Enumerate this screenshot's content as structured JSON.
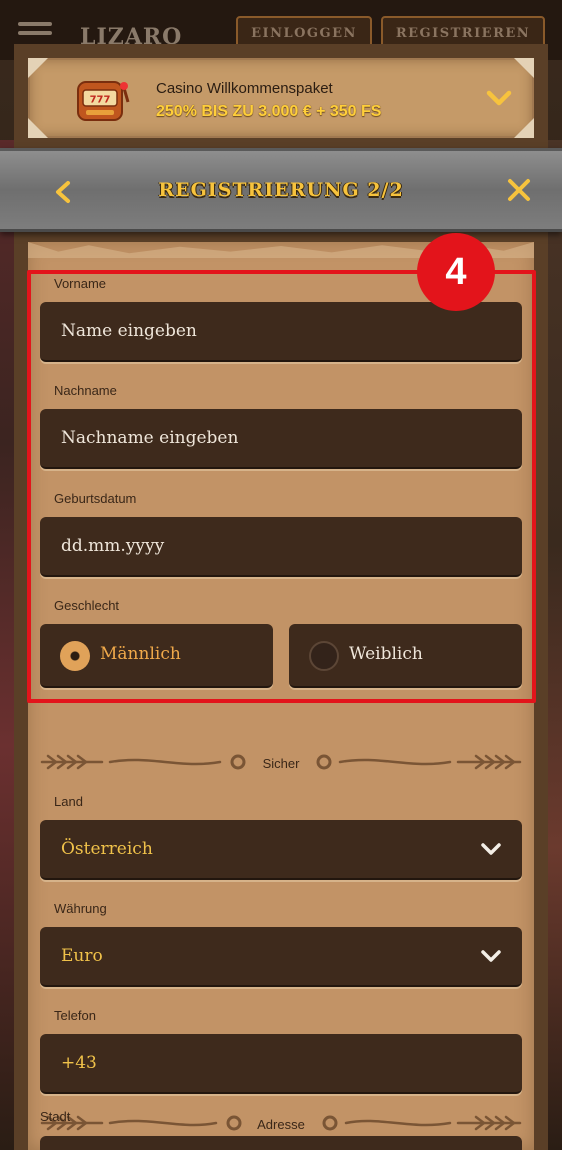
{
  "topbar": {
    "logo_text": "LIZARO",
    "login_label": "EINLOGGEN",
    "register_label": "REGISTRIEREN"
  },
  "promo": {
    "title": "Casino Willkommenspaket",
    "offer": "250% BIS ZU 3.000 € + 350 FS",
    "icon": "slot-machine-icon"
  },
  "header": {
    "title": "REGISTRIERUNG 2/2"
  },
  "form": {
    "first_name": {
      "label": "Vorname",
      "placeholder": "Name eingeben"
    },
    "last_name": {
      "label": "Nachname",
      "placeholder": "Nachname eingeben"
    },
    "birthdate": {
      "label": "Geburtsdatum",
      "placeholder": "dd.mm.yyyy"
    },
    "gender": {
      "label": "Geschlecht",
      "options": [
        {
          "label": "Männlich",
          "selected": true
        },
        {
          "label": "Weiblich",
          "selected": false
        }
      ]
    },
    "divider_secure": "Sicher",
    "country": {
      "label": "Land",
      "value": "Österreich"
    },
    "currency": {
      "label": "Währung",
      "value": "Euro"
    },
    "phone": {
      "label": "Telefon",
      "value": "+43"
    },
    "divider_address": "Adresse",
    "city": {
      "label": "Stadt"
    }
  },
  "annotation": {
    "badge": "4",
    "color": "#e3141b"
  },
  "colors": {
    "accent_gold": "#f7c33d",
    "input_bg": "#3e2a1c",
    "panel_bg": "#c29366",
    "radio_selected": "#e0a259"
  }
}
